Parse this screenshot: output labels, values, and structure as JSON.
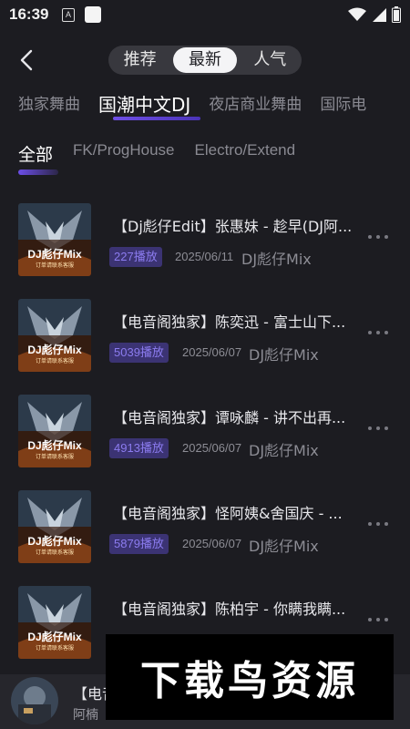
{
  "status": {
    "time": "16:39",
    "a_icon_label": "A"
  },
  "top_tabs": [
    "推荐",
    "最新",
    "人气"
  ],
  "categories": [
    "独家舞曲",
    "国潮中文DJ",
    "夜店商业舞曲",
    "国际电"
  ],
  "subtabs": [
    "全部",
    "FK/ProgHouse",
    "Electro/Extend"
  ],
  "cover_text": {
    "line1": "DJ彪仔Mix",
    "line2": "订单请联系客服"
  },
  "items": [
    {
      "title": "【Dj彪仔Edit】张惠妹 - 趁早(DJ阿...",
      "plays": "227播放",
      "date": "2025/06/11",
      "artist": "DJ彪仔Mix"
    },
    {
      "title": "【电音阁独家】陈奕迅 - 富士山下...",
      "plays": "5039播放",
      "date": "2025/06/07",
      "artist": "DJ彪仔Mix"
    },
    {
      "title": "【电音阁独家】谭咏麟 - 讲不出再...",
      "plays": "4913播放",
      "date": "2025/06/07",
      "artist": "DJ彪仔Mix"
    },
    {
      "title": "【电音阁独家】怪阿姨&舍国庆 - ...",
      "plays": "5879播放",
      "date": "2025/06/07",
      "artist": "DJ彪仔Mix"
    },
    {
      "title": "【电音阁独家】陈柏宇 - 你瞒我瞒...",
      "plays": "",
      "date": "",
      "artist": ""
    }
  ],
  "player": {
    "title": "【电音",
    "subtitle": "阿楠"
  },
  "watermark": "下载鸟资源",
  "colors": {
    "accent": "#6f4fe6",
    "badge_bg": "#3b3373",
    "badge_text": "#8c7cf0"
  }
}
